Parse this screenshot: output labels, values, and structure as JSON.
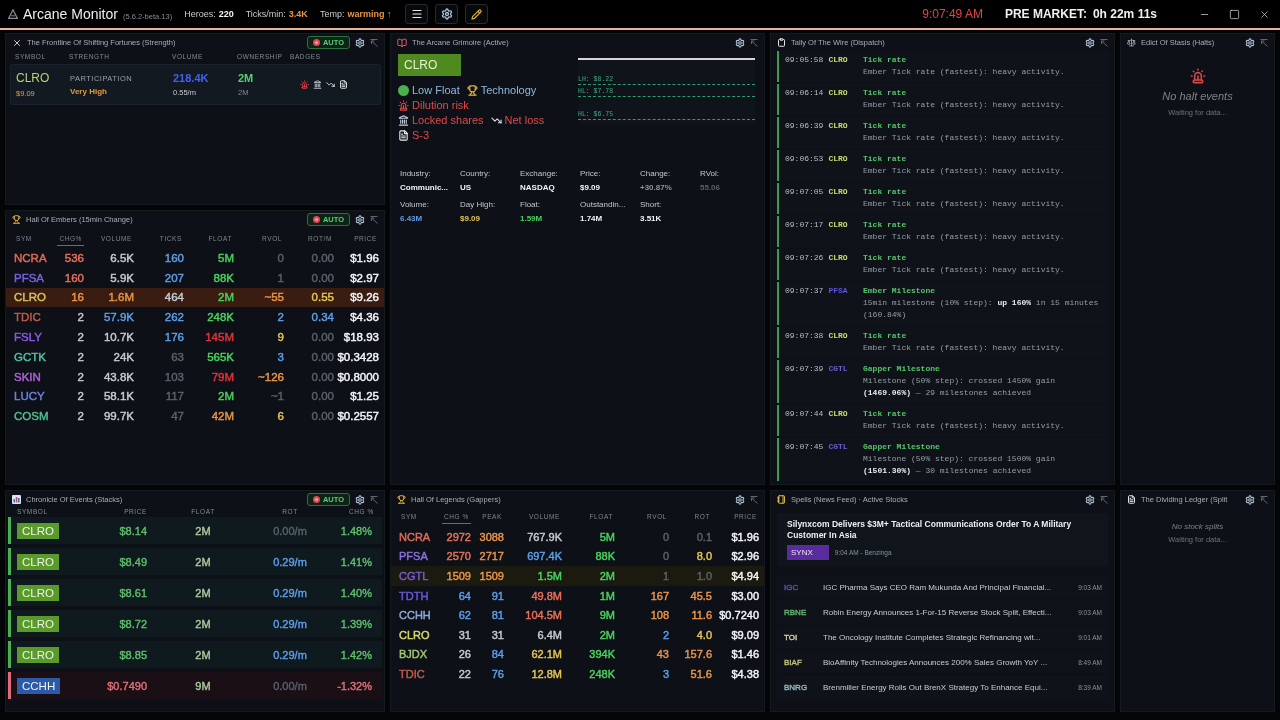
{
  "topbar": {
    "title": "Arcane Monitor",
    "version": "(5.6.2-beta.13)",
    "stats": [
      {
        "label": "Heroes:",
        "value": "220",
        "color": "#f2f4f6"
      },
      {
        "label": "Ticks/min:",
        "value": "3.4K",
        "color": "#e8944a"
      },
      {
        "label": "Temp:",
        "value": "warming ↑",
        "color": "#e8944a"
      }
    ],
    "clock": "9:07:49 AM",
    "session_label": "PRE MARKET:",
    "session_countdown": "0h 22m 11s"
  },
  "frontline": {
    "title": "The Frontline Of Shifting Fortunes (Strength)",
    "auto": {
      "label": "AUTO",
      "on": true
    },
    "columns": [
      "SYMBOL",
      "STRENGTH",
      "VOLUME",
      "OWNERSHIP",
      "BADGES"
    ],
    "rows": [
      {
        "symbol": "CLRO",
        "price": "$9.09",
        "strength_label": "PARTICIPATION",
        "strength": "Very High",
        "volume": "218.4K",
        "volume_rate": "0.55/m",
        "ownership": "2M",
        "ownership_sub": "2M",
        "badges": [
          {
            "kind": "dilution"
          },
          {
            "kind": "locked"
          },
          {
            "kind": "loss"
          },
          {
            "kind": "filing"
          }
        ]
      }
    ]
  },
  "grimoire": {
    "title": "The Arcane Grimoire (Active)",
    "symbol": "CLRO",
    "tags": [
      {
        "kind": "float",
        "label": "Low Float"
      },
      {
        "kind": "sector",
        "label": "Technology"
      },
      {
        "kind": "dilution",
        "label": "Dilution risk"
      },
      {
        "kind": "locked",
        "label": "Locked shares"
      },
      {
        "kind": "loss",
        "label": "Net loss"
      },
      {
        "kind": "filing",
        "label": "S-3"
      }
    ],
    "chart_levels": [
      "LH: $8.22",
      "HL: $7.78",
      "HL: $6.75"
    ],
    "facts": [
      {
        "label": "Industry:",
        "value": "Communic...",
        "color": "#f2f4f6"
      },
      {
        "label": "Country:",
        "value": "US",
        "color": "#f2f4f6"
      },
      {
        "label": "Exchange:",
        "value": "NASDAQ",
        "color": "#f2f4f6"
      },
      {
        "label": "Price:",
        "value": "$9.09",
        "color": "#f2f4f6"
      },
      {
        "label": "Change:",
        "value": "+30.87%",
        "color": "#8e959d"
      },
      {
        "label": "RVol:",
        "value": "55.06",
        "color": "#59606a"
      },
      {
        "label": "Volume:",
        "value": "6.43M",
        "color": "#5d9ee8"
      },
      {
        "label": "Day High:",
        "value": "$9.09",
        "color": "#e2c455"
      },
      {
        "label": "Float:",
        "value": "1.59M",
        "color": "#49d25e"
      },
      {
        "label": "Outstandin...",
        "value": "1.74M",
        "color": "#f2f4f6"
      },
      {
        "label": "Short:",
        "value": "3.51K",
        "color": "#f2f4f6"
      }
    ]
  },
  "dispatch": {
    "title": "Tally Of The Wire (Dispatch)",
    "entries": [
      {
        "time": "09:05:58",
        "symbol": "CLRO",
        "color": "#c6df6e",
        "title": "Tick rate",
        "detail": "Ember Tick rate (fastest): heavy activity."
      },
      {
        "time": "09:06:14",
        "symbol": "CLRO",
        "color": "#c6df6e",
        "title": "Tick rate",
        "detail": "Ember Tick rate (fastest): heavy activity."
      },
      {
        "time": "09:06:39",
        "symbol": "CLRO",
        "color": "#c6df6e",
        "title": "Tick rate",
        "detail": "Ember Tick rate (fastest): heavy activity."
      },
      {
        "time": "09:06:53",
        "symbol": "CLRO",
        "color": "#c6df6e",
        "title": "Tick rate",
        "detail": "Ember Tick rate (fastest): heavy activity."
      },
      {
        "time": "09:07:05",
        "symbol": "CLRO",
        "color": "#c6df6e",
        "title": "Tick rate",
        "detail": "Ember Tick rate (fastest): heavy activity."
      },
      {
        "time": "09:07:17",
        "symbol": "CLRO",
        "color": "#c6df6e",
        "title": "Tick rate",
        "detail": "Ember Tick rate (fastest): heavy activity."
      },
      {
        "time": "09:07:26",
        "symbol": "CLRO",
        "color": "#c6df6e",
        "title": "Tick rate",
        "detail": "Ember Tick rate (fastest): heavy activity."
      },
      {
        "time": "09:07:37",
        "symbol": "PFSA",
        "color": "#5b52e6",
        "title": "Ember Milestone",
        "detail": "15min milestone (10% step): **up 160%** in 15 minutes (160.84%)"
      },
      {
        "time": "09:07:38",
        "symbol": "CLRO",
        "color": "#c6df6e",
        "title": "Tick rate",
        "detail": "Ember Tick rate (fastest): heavy activity."
      },
      {
        "time": "09:07:39",
        "symbol": "CGTL",
        "color": "#6a5fd6",
        "title": "Gapper Milestone",
        "detail": "Milestone (50% step): crossed 1450% gain **(1469.06%)** — 29 milestones achieved"
      },
      {
        "time": "09:07:44",
        "symbol": "CLRO",
        "color": "#c6df6e",
        "title": "Tick rate",
        "detail": "Ember Tick rate (fastest): heavy activity."
      },
      {
        "time": "09:07:45",
        "symbol": "CGTL",
        "color": "#6a5fd6",
        "title": "Gapper Milestone",
        "detail": "Milestone (50% step): crossed 1500% gain **(1501.30%)** — 30 milestones achieved"
      }
    ]
  },
  "halts": {
    "title": "Edict Of Stasis (Halts)",
    "empty_title": "No halt events",
    "empty_hint": "Waiting for data..."
  },
  "embers": {
    "title": "Hall Of Embers (15min Change)",
    "auto": {
      "label": "AUTO",
      "on": true
    },
    "columns": [
      {
        "label": "SYM",
        "selected": false
      },
      {
        "label": "CHG%",
        "selected": true
      },
      {
        "label": "VOLUME",
        "selected": false
      },
      {
        "label": "TICKS",
        "selected": false
      },
      {
        "label": "FLOAT",
        "selected": false
      },
      {
        "label": "RVOL",
        "selected": false
      },
      {
        "label": "ROT/M",
        "selected": false
      },
      {
        "label": "PRICE",
        "selected": false
      }
    ],
    "rows": [
      {
        "selected": false,
        "cells": [
          {
            "text": "NCRA",
            "color": "#e06a5a"
          },
          {
            "text": "536",
            "color": "#e8705a"
          },
          {
            "text": "6.5K",
            "color": "#c5cad0"
          },
          {
            "text": "160",
            "color": "#5d9ee8"
          },
          {
            "text": "5M",
            "color": "#49d25e"
          },
          {
            "text": "0",
            "color": "#59606a"
          },
          {
            "text": "0.00",
            "color": "#59606a"
          },
          {
            "text": "$1.96",
            "color": "#f2f4f6"
          }
        ]
      },
      {
        "selected": false,
        "cells": [
          {
            "text": "PFSA",
            "color": "#7a60e0"
          },
          {
            "text": "160",
            "color": "#e8705a"
          },
          {
            "text": "5.9K",
            "color": "#c5cad0"
          },
          {
            "text": "207",
            "color": "#5d9ee8"
          },
          {
            "text": "88K",
            "color": "#49d25e"
          },
          {
            "text": "1",
            "color": "#59606a"
          },
          {
            "text": "0.00",
            "color": "#59606a"
          },
          {
            "text": "$2.97",
            "color": "#f2f4f6"
          }
        ]
      },
      {
        "selected": true,
        "cells": [
          {
            "text": "CLRO",
            "color": "#d8c060"
          },
          {
            "text": "16",
            "color": "#e8944a"
          },
          {
            "text": "1.6M",
            "color": "#e8944a"
          },
          {
            "text": "464",
            "color": "#c5cad0"
          },
          {
            "text": "2M",
            "color": "#49d25e"
          },
          {
            "text": "~55",
            "color": "#e8944a"
          },
          {
            "text": "0.55",
            "color": "#e2c455"
          },
          {
            "text": "$9.26",
            "color": "#f2f4f6"
          }
        ]
      },
      {
        "selected": false,
        "cells": [
          {
            "text": "TDIC",
            "color": "#c05a4a"
          },
          {
            "text": "2",
            "color": "#c5cad0"
          },
          {
            "text": "57.9K",
            "color": "#5d9ee8"
          },
          {
            "text": "262",
            "color": "#5d9ee8"
          },
          {
            "text": "248K",
            "color": "#49d25e"
          },
          {
            "text": "2",
            "color": "#5d9ee8"
          },
          {
            "text": "0.34",
            "color": "#5d9ee8"
          },
          {
            "text": "$4.36",
            "color": "#f2f4f6"
          }
        ]
      },
      {
        "selected": false,
        "cells": [
          {
            "text": "FSLY",
            "color": "#8a5ae8"
          },
          {
            "text": "2",
            "color": "#c5cad0"
          },
          {
            "text": "10.7K",
            "color": "#c5cad0"
          },
          {
            "text": "176",
            "color": "#5d9ee8"
          },
          {
            "text": "145M",
            "color": "#e2343a"
          },
          {
            "text": "9",
            "color": "#e2c455"
          },
          {
            "text": "0.00",
            "color": "#59606a"
          },
          {
            "text": "$18.93",
            "color": "#f2f4f6"
          }
        ]
      },
      {
        "selected": false,
        "cells": [
          {
            "text": "GCTK",
            "color": "#50c0a0"
          },
          {
            "text": "2",
            "color": "#c5cad0"
          },
          {
            "text": "24K",
            "color": "#c5cad0"
          },
          {
            "text": "63",
            "color": "#59606a"
          },
          {
            "text": "565K",
            "color": "#49d25e"
          },
          {
            "text": "3",
            "color": "#5d9ee8"
          },
          {
            "text": "0.00",
            "color": "#59606a"
          },
          {
            "text": "$0.3428",
            "color": "#f2f4f6"
          }
        ]
      },
      {
        "selected": false,
        "cells": [
          {
            "text": "SKIN",
            "color": "#b060d8"
          },
          {
            "text": "2",
            "color": "#c5cad0"
          },
          {
            "text": "43.8K",
            "color": "#c5cad0"
          },
          {
            "text": "103",
            "color": "#59606a"
          },
          {
            "text": "79M",
            "color": "#e2343a"
          },
          {
            "text": "~126",
            "color": "#e8944a"
          },
          {
            "text": "0.00",
            "color": "#59606a"
          },
          {
            "text": "$0.8000",
            "color": "#f2f4f6"
          }
        ]
      },
      {
        "selected": false,
        "cells": [
          {
            "text": "LUCY",
            "color": "#6a80e0"
          },
          {
            "text": "2",
            "color": "#c5cad0"
          },
          {
            "text": "58.1K",
            "color": "#c5cad0"
          },
          {
            "text": "117",
            "color": "#59606a"
          },
          {
            "text": "2M",
            "color": "#49d25e"
          },
          {
            "text": "~1",
            "color": "#59606a"
          },
          {
            "text": "0.00",
            "color": "#59606a"
          },
          {
            "text": "$1.25",
            "color": "#f2f4f6"
          }
        ]
      },
      {
        "selected": false,
        "cells": [
          {
            "text": "COSM",
            "color": "#50c090"
          },
          {
            "text": "2",
            "color": "#c5cad0"
          },
          {
            "text": "99.7K",
            "color": "#c5cad0"
          },
          {
            "text": "47",
            "color": "#59606a"
          },
          {
            "text": "42M",
            "color": "#e8944a"
          },
          {
            "text": "6",
            "color": "#e2c455"
          },
          {
            "text": "0.00",
            "color": "#59606a"
          },
          {
            "text": "$0.2557",
            "color": "#f2f4f6"
          }
        ]
      }
    ]
  },
  "chronicle": {
    "title": "Chronicle Of Events (Stacks)",
    "auto": {
      "label": "AUTO",
      "on": true
    },
    "columns": [
      "SYMBOL",
      "PRICE",
      "FLOAT",
      "ROT",
      "CHG %"
    ],
    "rows": [
      {
        "kind": "up",
        "symbol": "CLRO",
        "color": "#5a9a2a",
        "price": "$8.14",
        "float": "2M",
        "rot": {
          "text": "0.00/m",
          "color": "#59606a"
        },
        "change": "1.48%"
      },
      {
        "kind": "up",
        "symbol": "CLRO",
        "color": "#5a9a2a",
        "price": "$8.49",
        "float": "2M",
        "rot": {
          "text": "0.29/m",
          "color": "#5d9ee8"
        },
        "change": "1.41%"
      },
      {
        "kind": "up",
        "symbol": "CLRO",
        "color": "#5a9a2a",
        "price": "$8.61",
        "float": "2M",
        "rot": {
          "text": "0.29/m",
          "color": "#5d9ee8"
        },
        "change": "1.40%"
      },
      {
        "kind": "up",
        "symbol": "CLRO",
        "color": "#5a9a2a",
        "price": "$8.72",
        "float": "2M",
        "rot": {
          "text": "0.29/m",
          "color": "#5d9ee8"
        },
        "change": "1.39%"
      },
      {
        "kind": "up",
        "symbol": "CLRO",
        "color": "#5a9a2a",
        "price": "$8.85",
        "float": "2M",
        "rot": {
          "text": "0.29/m",
          "color": "#5d9ee8"
        },
        "change": "1.42%"
      },
      {
        "kind": "down",
        "symbol": "CCHH",
        "color": "#2a5aa8",
        "price": "$0.7490",
        "float": "9M",
        "rot": {
          "text": "0.00/m",
          "color": "#59606a"
        },
        "change": "-1.32%"
      }
    ]
  },
  "legends": {
    "title": "Hall Of Legends (Gappers)",
    "columns": [
      {
        "label": "SYM",
        "selected": false
      },
      {
        "label": "CHG %",
        "selected": true
      },
      {
        "label": "PEAK",
        "selected": false
      },
      {
        "label": "VOLUME",
        "selected": false
      },
      {
        "label": "FLOAT",
        "selected": false
      },
      {
        "label": "RVOL",
        "selected": false
      },
      {
        "label": "ROT",
        "selected": false
      },
      {
        "label": "PRICE",
        "selected": false
      }
    ],
    "rows": [
      {
        "selected": false,
        "cells": [
          {
            "text": "NCRA",
            "color": "#e06a5a"
          },
          {
            "text": "2972",
            "color": "#e8705a"
          },
          {
            "text": "3088",
            "color": "#e8944a"
          },
          {
            "text": "767.9K",
            "color": "#c5cad0"
          },
          {
            "text": "5M",
            "color": "#49d25e"
          },
          {
            "text": "0",
            "color": "#59606a"
          },
          {
            "text": "0.1",
            "color": "#59606a"
          },
          {
            "text": "$1.96",
            "color": "#f2f4f6"
          }
        ]
      },
      {
        "selected": false,
        "cells": [
          {
            "text": "PFSA",
            "color": "#8a70e0"
          },
          {
            "text": "2570",
            "color": "#e8705a"
          },
          {
            "text": "2717",
            "color": "#e8944a"
          },
          {
            "text": "697.4K",
            "color": "#5d9ee8"
          },
          {
            "text": "88K",
            "color": "#49d25e"
          },
          {
            "text": "0",
            "color": "#59606a"
          },
          {
            "text": "8.0",
            "color": "#e2c455"
          },
          {
            "text": "$2.96",
            "color": "#f2f4f6"
          }
        ]
      },
      {
        "selected": true,
        "cells": [
          {
            "text": "CGTL",
            "color": "#7a5ad8"
          },
          {
            "text": "1509",
            "color": "#e8944a"
          },
          {
            "text": "1509",
            "color": "#e8944a"
          },
          {
            "text": "1.5M",
            "color": "#49d25e"
          },
          {
            "text": "2M",
            "color": "#49d25e"
          },
          {
            "text": "1",
            "color": "#59606a"
          },
          {
            "text": "1.0",
            "color": "#59606a"
          },
          {
            "text": "$4.94",
            "color": "#f2f4f6"
          }
        ]
      },
      {
        "selected": false,
        "cells": [
          {
            "text": "TDTH",
            "color": "#6a5ad8"
          },
          {
            "text": "64",
            "color": "#5d9ee8"
          },
          {
            "text": "91",
            "color": "#5d9ee8"
          },
          {
            "text": "49.8M",
            "color": "#e8705a"
          },
          {
            "text": "1M",
            "color": "#49d25e"
          },
          {
            "text": "167",
            "color": "#e8944a"
          },
          {
            "text": "45.5",
            "color": "#e8944a"
          },
          {
            "text": "$3.00",
            "color": "#f2f4f6"
          }
        ]
      },
      {
        "selected": false,
        "cells": [
          {
            "text": "CCHH",
            "color": "#90a8d8"
          },
          {
            "text": "62",
            "color": "#5d9ee8"
          },
          {
            "text": "81",
            "color": "#5d9ee8"
          },
          {
            "text": "104.5M",
            "color": "#e8705a"
          },
          {
            "text": "9M",
            "color": "#49d25e"
          },
          {
            "text": "108",
            "color": "#e8944a"
          },
          {
            "text": "11.6",
            "color": "#e8944a"
          },
          {
            "text": "$0.7240",
            "color": "#f2f4f6"
          }
        ]
      },
      {
        "selected": false,
        "cells": [
          {
            "text": "CLRO",
            "color": "#d8d870"
          },
          {
            "text": "31",
            "color": "#c5cad0"
          },
          {
            "text": "31",
            "color": "#c5cad0"
          },
          {
            "text": "6.4M",
            "color": "#c5cad0"
          },
          {
            "text": "2M",
            "color": "#49d25e"
          },
          {
            "text": "2",
            "color": "#5d9ee8"
          },
          {
            "text": "4.0",
            "color": "#e2c455"
          },
          {
            "text": "$9.09",
            "color": "#f2f4f6"
          }
        ]
      },
      {
        "selected": false,
        "cells": [
          {
            "text": "BJDX",
            "color": "#a0c870"
          },
          {
            "text": "26",
            "color": "#c5cad0"
          },
          {
            "text": "84",
            "color": "#5d9ee8"
          },
          {
            "text": "62.1M",
            "color": "#e2c455"
          },
          {
            "text": "394K",
            "color": "#49d25e"
          },
          {
            "text": "43",
            "color": "#e8944a"
          },
          {
            "text": "157.6",
            "color": "#e8944a"
          },
          {
            "text": "$1.46",
            "color": "#f2f4f6"
          }
        ]
      },
      {
        "selected": false,
        "cells": [
          {
            "text": "TDIC",
            "color": "#c05a4a"
          },
          {
            "text": "22",
            "color": "#c5cad0"
          },
          {
            "text": "76",
            "color": "#5d9ee8"
          },
          {
            "text": "12.8M",
            "color": "#e2c455"
          },
          {
            "text": "248K",
            "color": "#49d25e"
          },
          {
            "text": "3",
            "color": "#5d9ee8"
          },
          {
            "text": "51.6",
            "color": "#e8944a"
          },
          {
            "text": "$4.38",
            "color": "#f2f4f6"
          }
        ]
      }
    ]
  },
  "news": {
    "title": "Spells (News Feed) · Active Stocks",
    "featured": {
      "headline": "Silynxcom Delivers $3M+ Tactical Communications Order To A Military Customer In Asia",
      "ticker": "SYNX",
      "color": "#5a2b9c",
      "time": "9:04 AM - Benzinga"
    },
    "items": [
      {
        "ticker": "IGC",
        "color": "#5d50b4",
        "headline": "IGC Pharma Says CEO Ram Mukunda And Principal Financial...",
        "time": "9:03 AM"
      },
      {
        "ticker": "RBNE",
        "color": "#62b06a",
        "headline": "Robin Energy Announces 1-For-15 Reverse Stock Split, Effecti...",
        "time": "9:03 AM"
      },
      {
        "ticker": "TOI",
        "color": "#d2d0a8",
        "headline": "The Oncology Institute Completes Strategic Refinancing wit...",
        "time": "9:01 AM"
      },
      {
        "ticker": "BIAF",
        "color": "#c2bd78",
        "headline": "BioAffinity Technologies Announces 200% Sales Growth YoY ...",
        "time": "8:49 AM"
      },
      {
        "ticker": "BNRG",
        "color": "#8fb4bc",
        "headline": "Brenmiller Energy Rolls Out BrenX Strategy To Enhance Equi...",
        "time": "8:39 AM"
      }
    ]
  },
  "splits": {
    "title": "The Dividing Ledger (Split",
    "empty_title": "No stock splits",
    "empty_hint": "Waiting for data..."
  }
}
